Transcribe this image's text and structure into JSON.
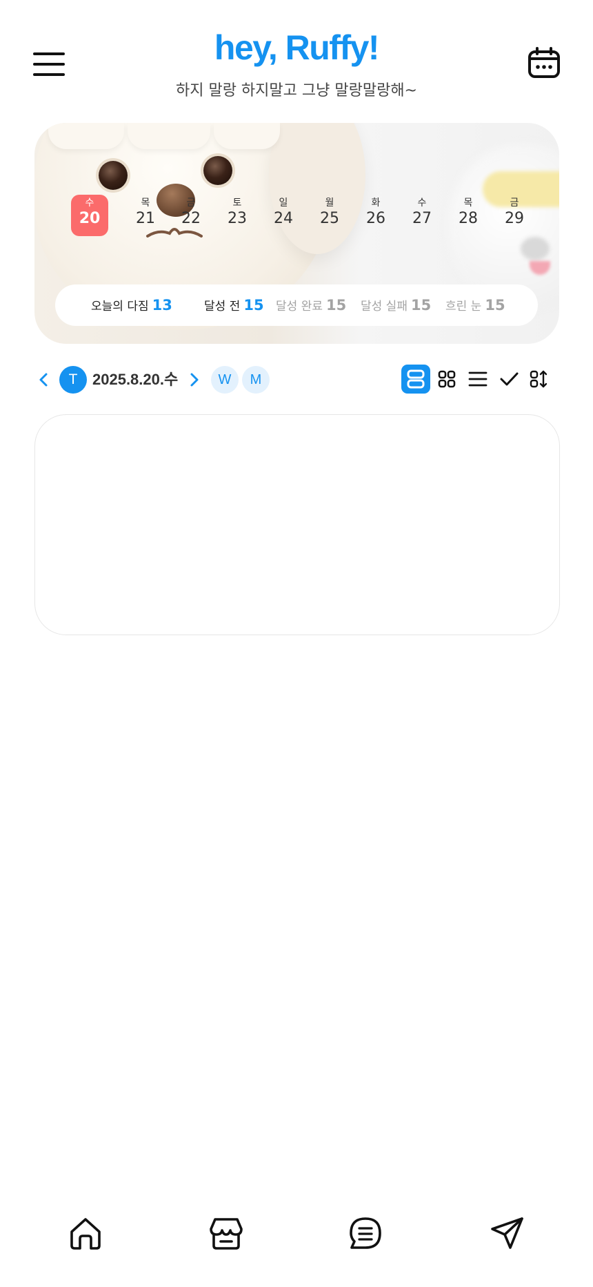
{
  "header": {
    "app_title": "hey, Ruffy!",
    "subtitle": "하지 말랑 하지말고 그냥 말랑말랑해~"
  },
  "calendar_strip": {
    "days": [
      {
        "weekday": "수",
        "date": "20",
        "selected": true
      },
      {
        "weekday": "목",
        "date": "21"
      },
      {
        "weekday": "금",
        "date": "22"
      },
      {
        "weekday": "토",
        "date": "23"
      },
      {
        "weekday": "일",
        "date": "24"
      },
      {
        "weekday": "월",
        "date": "25"
      },
      {
        "weekday": "화",
        "date": "26"
      },
      {
        "weekday": "수",
        "date": "27"
      },
      {
        "weekday": "목",
        "date": "28"
      },
      {
        "weekday": "금",
        "date": "29"
      }
    ]
  },
  "stats": [
    {
      "label": "오늘의 다짐",
      "value": "13"
    },
    {
      "label": "달성 전",
      "value": "15"
    },
    {
      "label": "달성 완료",
      "value": "15"
    },
    {
      "label": "달성 실패",
      "value": "15"
    },
    {
      "label": "흐린 눈",
      "value": "15"
    }
  ],
  "date_nav": {
    "today_label": "T",
    "current_date": "2025.8.20.수",
    "week_label": "W",
    "month_label": "M"
  },
  "colors": {
    "brand": "#1592f0",
    "selected_day": "#fb6b6b",
    "muted_text": "#a3a3a3"
  },
  "icons": {
    "menu": "menu-icon",
    "calendar": "calendar-icon",
    "views": [
      "view-rows-icon",
      "view-grid-icon",
      "view-list-icon",
      "check-icon",
      "sort-icon"
    ],
    "bottom_nav": [
      "home-icon",
      "store-icon",
      "chat-icon",
      "send-icon"
    ]
  }
}
